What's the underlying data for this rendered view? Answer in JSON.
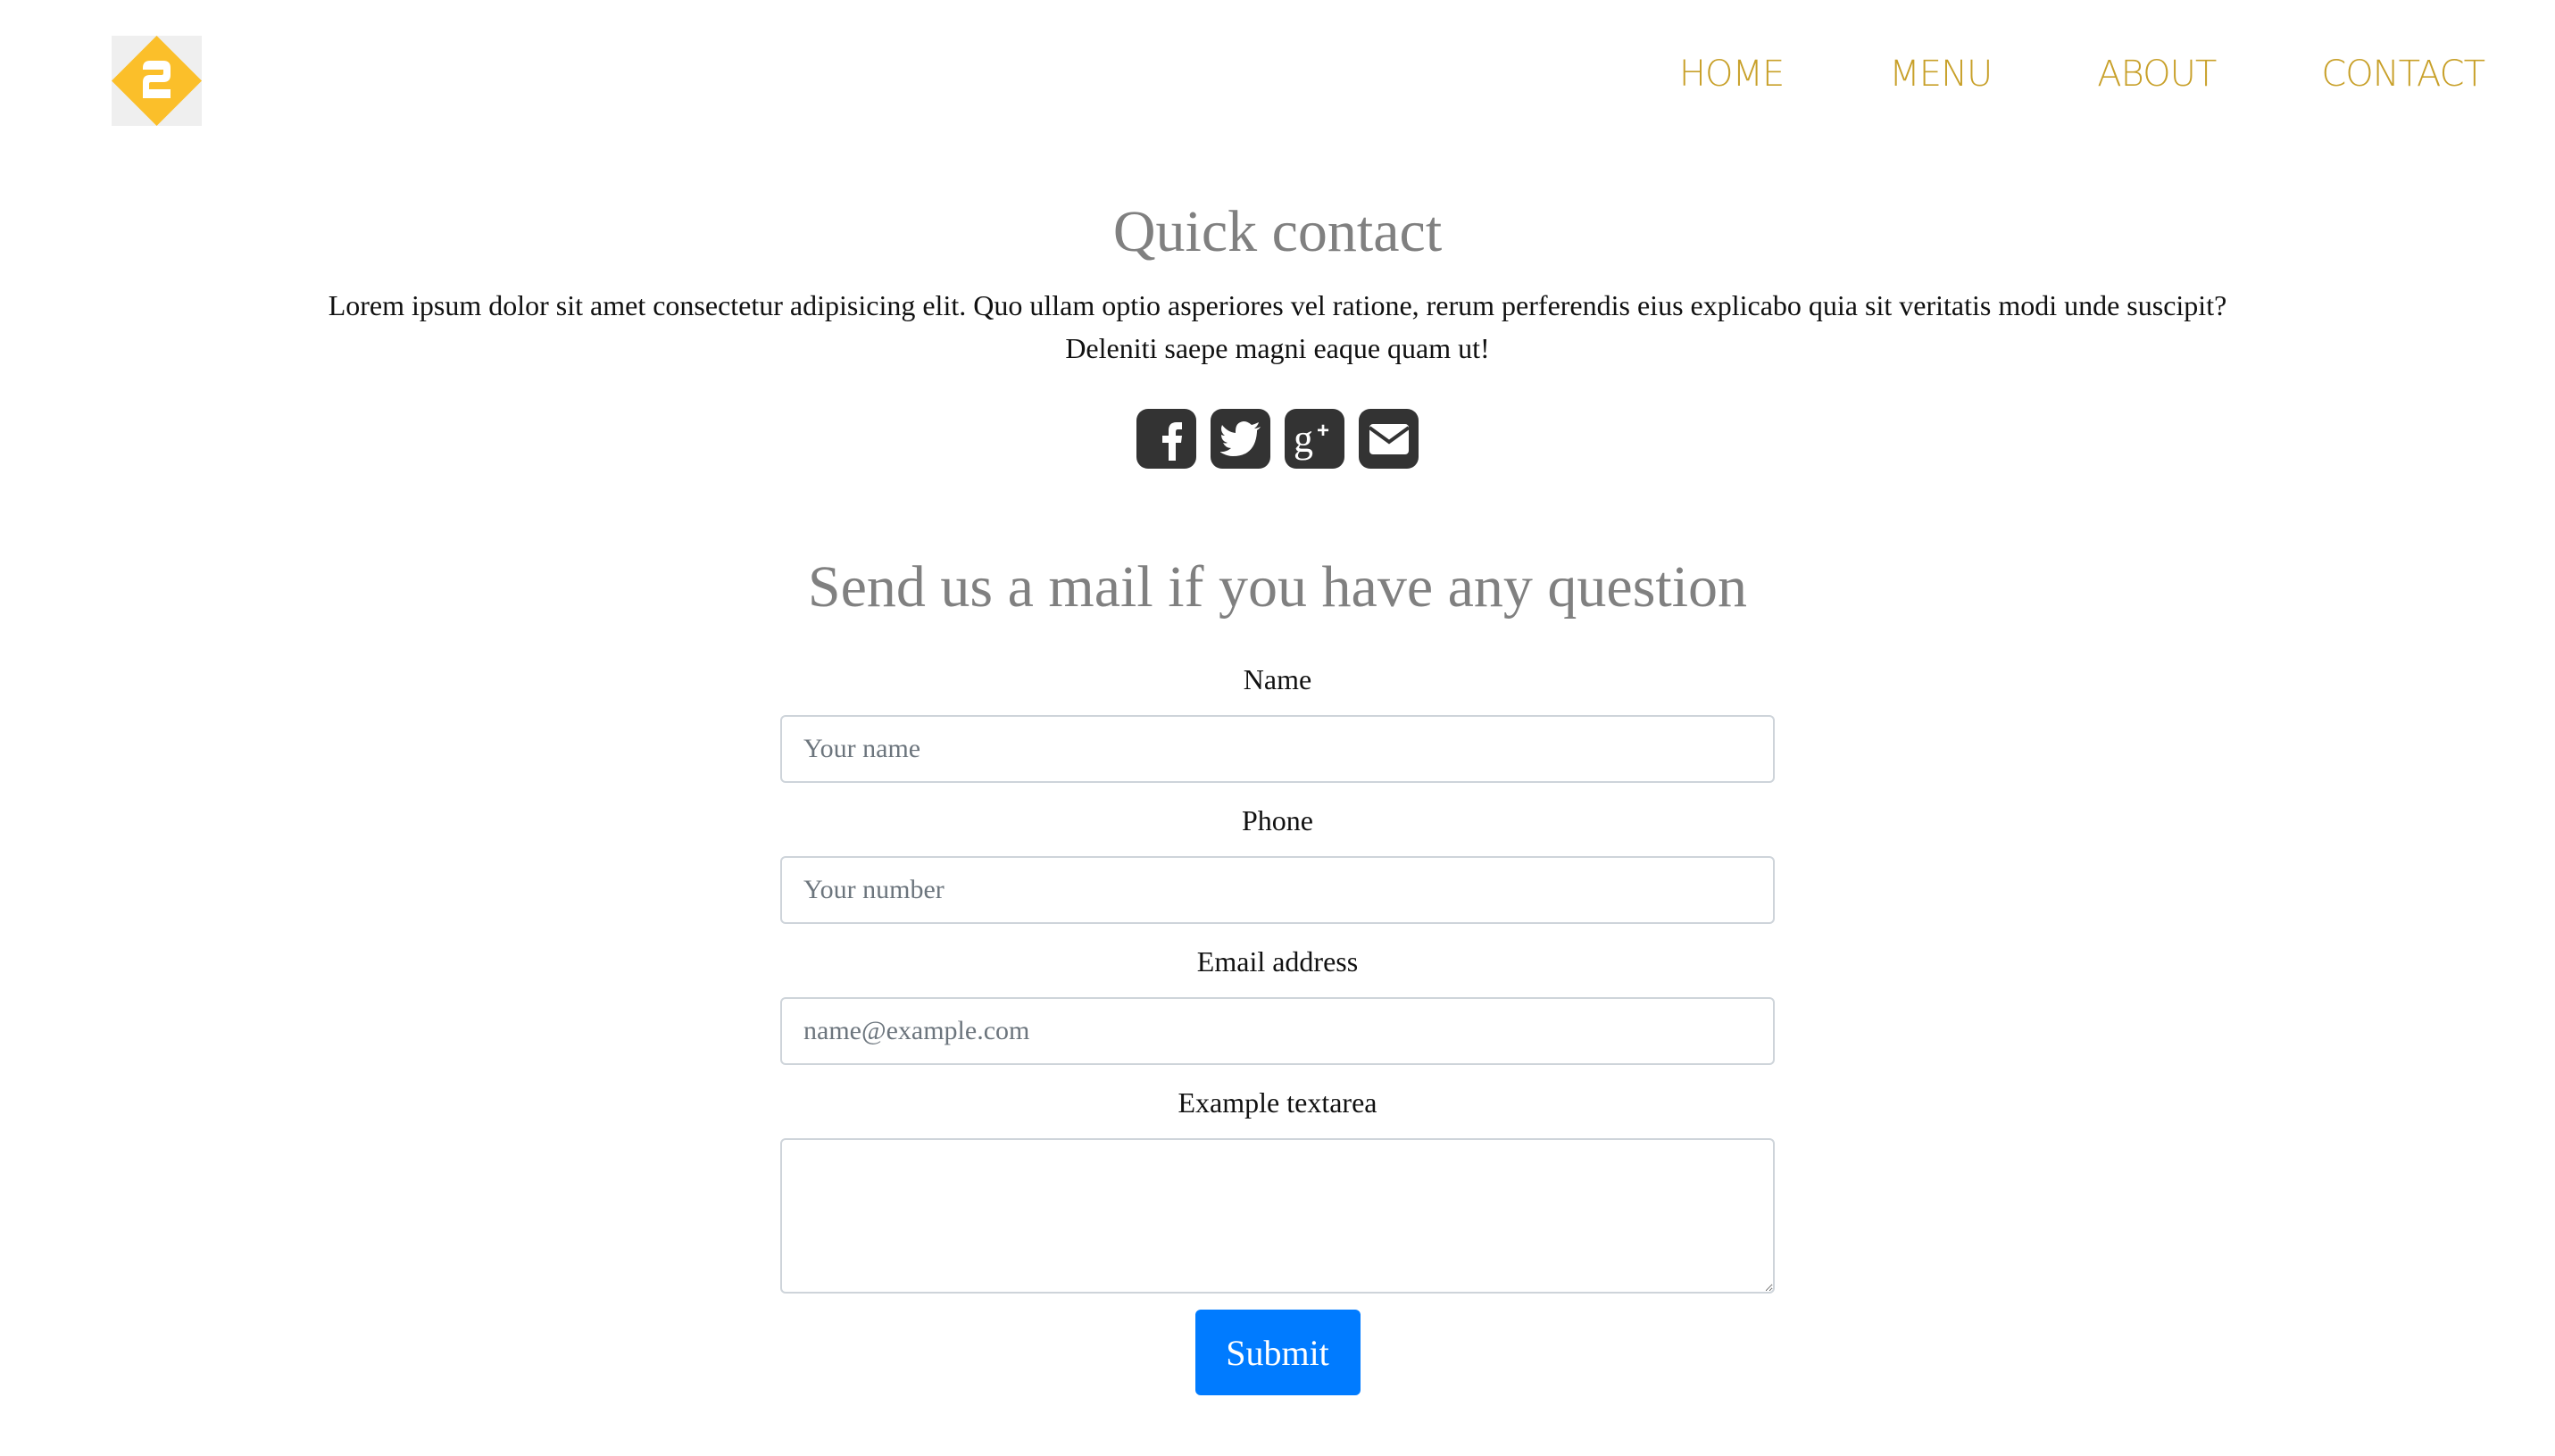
{
  "header": {
    "logo_icon": "diamond-2-logo-icon",
    "nav": [
      {
        "label": "HOME"
      },
      {
        "label": "MENU"
      },
      {
        "label": "ABOUT"
      },
      {
        "label": "CONTACT"
      }
    ],
    "nav_color": "#c8a029",
    "logo_color": "#fbbf2a"
  },
  "quick_contact": {
    "title": "Quick contact",
    "text_line1": "Lorem ipsum dolor sit amet consectetur adipisicing elit. Quo ullam optio asperiores vel ratione, rerum perferendis eius explicabo quia sit veritatis modi unde suscipit?",
    "text_line2": "Deleniti saepe magni eaque quam ut!",
    "social": [
      "facebook-icon",
      "twitter-icon",
      "google-plus-icon",
      "envelope-icon"
    ]
  },
  "form": {
    "title": "Send us a mail if you have any question",
    "name_label": "Name",
    "name_placeholder": "Your name",
    "phone_label": "Phone",
    "phone_placeholder": "Your number",
    "email_label": "Email address",
    "email_placeholder": "name@example.com",
    "textarea_label": "Example textarea",
    "submit_label": "Submit",
    "submit_color": "#007bff"
  }
}
